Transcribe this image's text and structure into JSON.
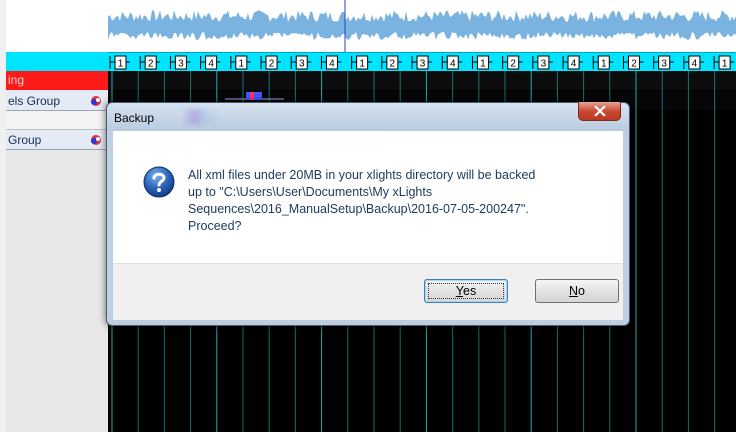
{
  "rows": {
    "timing_label": "ing",
    "model_1_label": "els Group",
    "model_2_label": "Group"
  },
  "timing_marks": [
    "1",
    "2",
    "3",
    "4",
    "1",
    "2",
    "3",
    "4",
    "1",
    "2",
    "3",
    "4",
    "1",
    "2",
    "3",
    "4",
    "1",
    "2",
    "3",
    "4",
    "1"
  ],
  "dialog": {
    "title": "Backup",
    "message_lines": [
      "All xml files under 20MB in your xlights directory will be backed",
      "up to \"C:\\Users\\User\\Documents\\My xLights",
      "Sequences\\2016_ManualSetup\\Backup\\2016-07-05-200247\".",
      "Proceed?"
    ],
    "yes_mnemonic": "Y",
    "yes_rest": "es",
    "no_mnemonic": "N",
    "no_rest": "o"
  },
  "colors": {
    "timing_track": "#00e5ff",
    "timing_row": "#ff1a1a",
    "grid_line": "#1fb8b8",
    "waveform": "#5aa0d8"
  },
  "icons": {
    "dialog": "question-icon",
    "close": "close-icon",
    "row": "model-color-icon"
  }
}
